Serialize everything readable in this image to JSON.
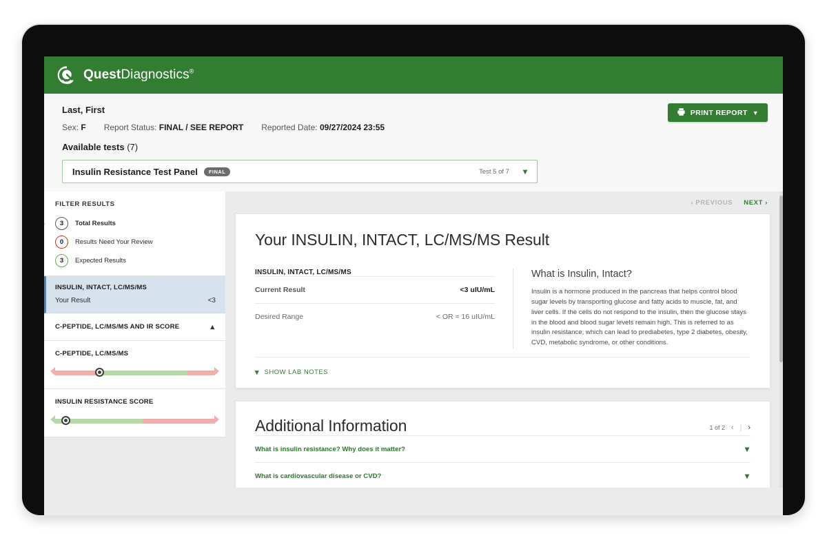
{
  "brand": {
    "name_bold": "Quest",
    "name_light": "Diagnostics",
    "registered": "®",
    "logo_icon": "quest-q-logo-icon",
    "bar_color": "#327d32"
  },
  "patient": {
    "name": "Last, First",
    "sex_label": "Sex:",
    "sex_value": "F",
    "status_label": "Report Status:",
    "status_value": "FINAL / SEE REPORT",
    "reported_label": "Reported Date:",
    "reported_value": "09/27/2024 23:55"
  },
  "toolbar": {
    "print_label": "PRINT REPORT",
    "print_icon": "printer-icon",
    "print_chevron": "chevron-down-icon"
  },
  "available": {
    "title": "Available tests",
    "count": "(7)",
    "selected_test": "Insulin Resistance Test Panel",
    "status_badge": "FINAL",
    "position": "Test 5 of 7",
    "chevron": "chevron-down-icon"
  },
  "sidebar": {
    "filter_header": "FILTER RESULTS",
    "filters": [
      {
        "count": "3",
        "label": "Total Results",
        "style": "neutral",
        "active": true
      },
      {
        "count": "0",
        "label": "Results Need Your Review",
        "style": "red",
        "active": false
      },
      {
        "count": "3",
        "label": "Expected Results",
        "style": "green",
        "active": false
      }
    ],
    "selected_item": {
      "title": "INSULIN, INTACT, LC/MS/MS",
      "row_label": "Your Result",
      "row_value": "<3"
    },
    "collapse_section": {
      "title": "C-PEPTIDE, LC/MS/MS AND IR SCORE",
      "chevron": "chevron-up-icon"
    },
    "gauges": [
      {
        "title": "C-PEPTIDE, LC/MS/MS",
        "marker_pct": 28,
        "green_start_pct": 28,
        "green_end_pct": 83
      },
      {
        "title": "INSULIN RESISTANCE SCORE",
        "marker_pct": 7,
        "green_start_pct": 2,
        "green_end_pct": 55
      }
    ]
  },
  "pager": {
    "previous": "PREVIOUS",
    "next": "NEXT",
    "prev_icon": "chevron-left-icon",
    "next_icon": "chevron-right-icon"
  },
  "result": {
    "heading": "Your INSULIN, INTACT, LC/MS/MS Result",
    "panel_title": "INSULIN, INTACT, LC/MS/MS",
    "rows": [
      {
        "label": "Current Result",
        "value": "<3 uIU/mL"
      },
      {
        "label": "Desired Range",
        "value": "< OR = 16 uIU/mL"
      }
    ],
    "about_title": "What is Insulin, Intact?",
    "about_body": "Insulin is a hormone produced in the pancreas that helps control blood sugar levels by transporting glucose and fatty acids to muscle, fat, and liver cells. If the cells do not respond to the insulin, then the glucose stays in the blood and blood sugar levels remain high. This is referred to as insulin resistance, which can lead to prediabetes, type 2 diabetes, obesity, CVD, metabolic syndrome, or other conditions.",
    "lab_notes_label": "SHOW LAB NOTES",
    "lab_notes_icon": "chevron-down-icon"
  },
  "additional": {
    "title": "Additional Information",
    "page_indicator": "1 of 2",
    "prev_icon": "chevron-left-icon",
    "divider": "|",
    "next_icon": "chevron-right-icon",
    "faqs": [
      {
        "question": "What is insulin resistance? Why does it matter?",
        "chevron": "chevron-down-icon"
      },
      {
        "question": "What is cardiovascular disease or CVD?",
        "chevron": "chevron-down-icon"
      }
    ]
  }
}
